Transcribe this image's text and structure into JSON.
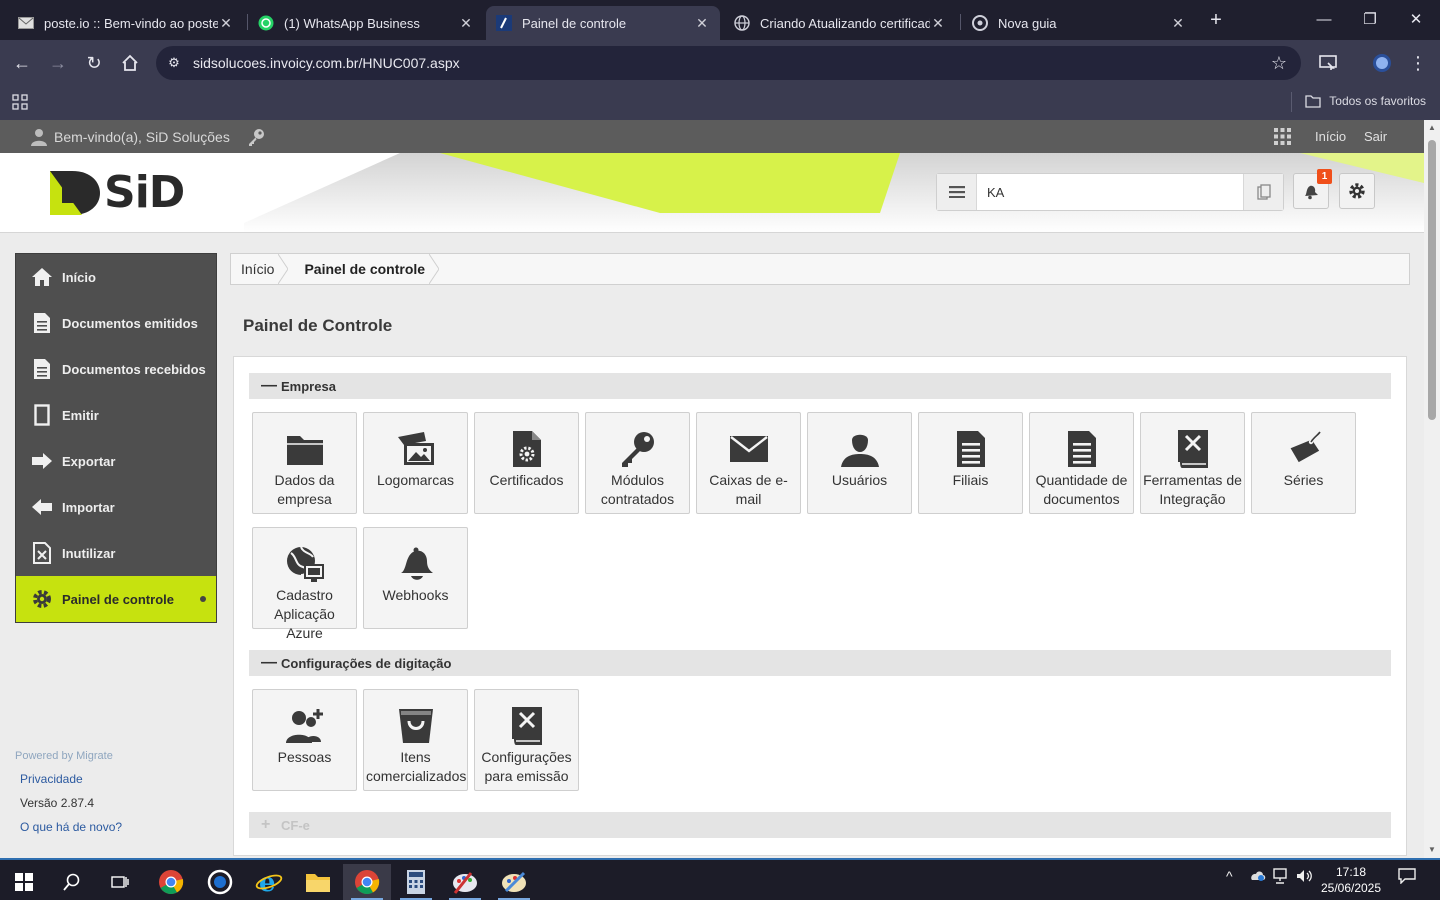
{
  "browser": {
    "tabs": [
      {
        "title": "poste.io :: Bem-vindo ao poste.io",
        "icon": "mail-icon"
      },
      {
        "title": "(1) WhatsApp Business",
        "icon": "whatsapp-icon"
      },
      {
        "title": "Painel de controle",
        "icon": "invoicy-icon",
        "active": true
      },
      {
        "title": "Criando Atualizando certificado",
        "icon": "globe-icon"
      },
      {
        "title": "Nova guia",
        "icon": "chrome-icon"
      }
    ],
    "new_tab_label": "+",
    "url": "sidsolucoes.invoicy.com.br/HNUC007.aspx",
    "bookmarks_label": "Todos os favoritos"
  },
  "topbar": {
    "welcome": "Bem-vindo(a), SiD Soluções",
    "links": [
      "Início",
      "Sair"
    ]
  },
  "header": {
    "logo_text": "SiD",
    "search_value": "KA",
    "notification_count": "1"
  },
  "sidebar": {
    "items": [
      {
        "label": "Início",
        "icon": "home-icon"
      },
      {
        "label": "Documentos emitidos",
        "icon": "document-icon"
      },
      {
        "label": "Documentos recebidos",
        "icon": "document-icon"
      },
      {
        "label": "Emitir",
        "icon": "blank-doc-icon"
      },
      {
        "label": "Exportar",
        "icon": "arrow-right-icon"
      },
      {
        "label": "Importar",
        "icon": "arrow-left-icon"
      },
      {
        "label": "Inutilizar",
        "icon": "cancel-doc-icon"
      },
      {
        "label": "Painel de controle",
        "icon": "gear-icon",
        "active": true
      }
    ],
    "powered_by": "Powered by Migrate",
    "privacy": "Privacidade",
    "version": "Versão 2.87.4",
    "whats_new": "O que há de novo?"
  },
  "breadcrumb": [
    "Início",
    "Painel de controle"
  ],
  "page_title": "Painel de Controle",
  "sections": [
    {
      "title": "Empresa",
      "toggle": "—",
      "tiles": [
        {
          "label": "Dados da empresa",
          "icon": "folder-icon"
        },
        {
          "label": "Logomarcas",
          "icon": "images-icon"
        },
        {
          "label": "Certificados",
          "icon": "certificate-icon"
        },
        {
          "label": "Módulos contratados",
          "icon": "key-icon"
        },
        {
          "label": "Caixas de e-mail",
          "icon": "envelope-icon"
        },
        {
          "label": "Usuários",
          "icon": "user-icon"
        },
        {
          "label": "Filiais",
          "icon": "list-doc-icon"
        },
        {
          "label": "Quantidade de documentos",
          "icon": "list-doc-icon"
        },
        {
          "label": "Ferramentas de Integração",
          "icon": "tools-book-icon"
        },
        {
          "label": "Séries",
          "icon": "tag-icon"
        },
        {
          "label": "Cadastro Aplicação Azure",
          "icon": "azure-app-icon"
        },
        {
          "label": "Webhooks",
          "icon": "bell-icon"
        }
      ]
    },
    {
      "title": "Configurações de digitação",
      "toggle": "—",
      "tiles": [
        {
          "label": "Pessoas",
          "icon": "people-icon"
        },
        {
          "label": "Itens comercializados",
          "icon": "basket-icon"
        },
        {
          "label": "Configurações para emissão",
          "icon": "tools-book-icon"
        }
      ]
    },
    {
      "title": "CF-e",
      "toggle": "+",
      "tiles": []
    }
  ],
  "taskbar": {
    "time": "17:18",
    "date": "25/06/2025"
  }
}
